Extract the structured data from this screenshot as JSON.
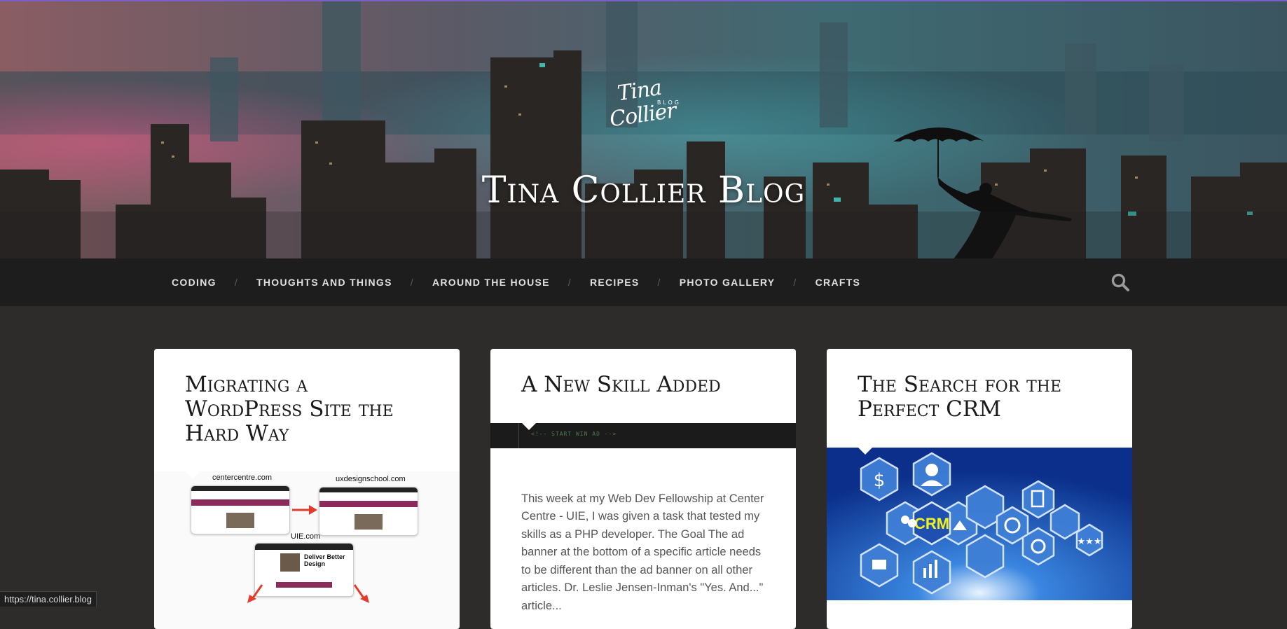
{
  "site": {
    "logo_script": "Tina Collier",
    "logo_sub": "BLOG",
    "title": "Tina Collier Blog"
  },
  "nav": {
    "items": [
      "CODING",
      "THOUGHTS AND THINGS",
      "AROUND THE HOUSE",
      "RECIPES",
      "PHOTO GALLERY",
      "CRAFTS"
    ],
    "separator": "/",
    "search_icon": "search-icon"
  },
  "posts": [
    {
      "title": "Migrating a WordPress Site the Hard Way",
      "thumb_labels": [
        "centercentre.com",
        "uxdesignschool.com",
        "UIE.com"
      ],
      "thumb_caption": "Deliver Better Design"
    },
    {
      "title": "A New Skill Added",
      "code_line": "<!-- START WIN AD -->",
      "excerpt": "This week at my Web Dev Fellowship at Center Centre - UIE, I was given a task that tested my skills as a PHP developer. The Goal The ad banner at the bottom of a specific article needs to be different than the ad banner on all other articles. Dr. Leslie Jensen-Inman's \"Yes. And...\" article..."
    },
    {
      "title": "The Search for the Perfect CRM",
      "thumb_label": "CRM"
    }
  ],
  "status_bar": {
    "url": "https://tina.collier.blog"
  }
}
